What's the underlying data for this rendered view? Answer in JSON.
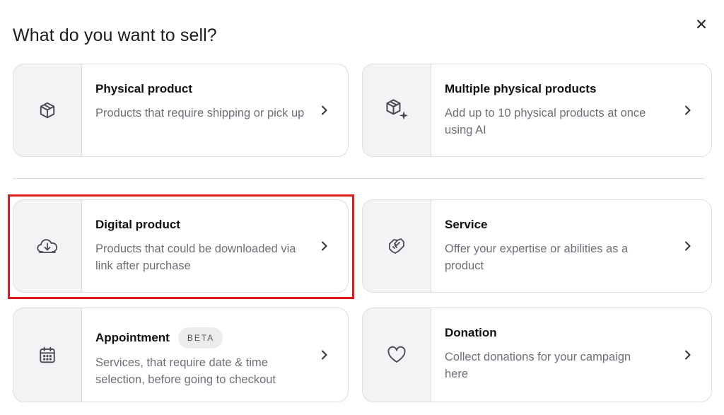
{
  "page": {
    "title": "What do you want to sell?"
  },
  "close": {
    "icon": "close-icon"
  },
  "cards": [
    {
      "id": "physical",
      "icon": "box-icon",
      "title": "Physical product",
      "desc": "Products that require shipping or pick up"
    },
    {
      "id": "multiple",
      "icon": "box-sparkle-icon",
      "title": "Multiple physical products",
      "desc": "Add up to 10 physical products at once using AI"
    },
    {
      "id": "digital",
      "icon": "cloud-download-icon",
      "title": "Digital product",
      "desc": "Products that could be downloaded via link after purchase"
    },
    {
      "id": "service",
      "icon": "handshake-icon",
      "title": "Service",
      "desc": "Offer your expertise or abilities as a product"
    },
    {
      "id": "appointment",
      "icon": "calendar-icon",
      "title": "Appointment",
      "badge": "BETA",
      "desc": "Services, that require date & time selection, before going to checkout"
    },
    {
      "id": "donation",
      "icon": "heart-icon",
      "title": "Donation",
      "desc": "Collect donations for your campaign here"
    }
  ],
  "colors": {
    "highlight": "#e11d1d",
    "icon_bg": "#f3f3f6",
    "border": "#dcdce2",
    "muted_text": "#6f6f79"
  }
}
